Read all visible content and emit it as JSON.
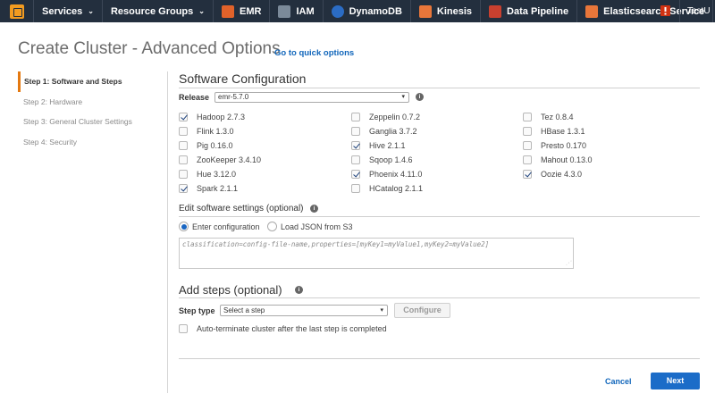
{
  "nav": {
    "services_label": "Services",
    "resource_groups_label": "Resource Groups",
    "caret": "⌄",
    "shortcuts": [
      {
        "label": "EMR",
        "color": "#e1622a"
      },
      {
        "label": "IAM",
        "color": "#7b8a99"
      },
      {
        "label": "DynamoDB",
        "color": "#2b6cc4"
      },
      {
        "label": "Kinesis",
        "color": "#e8763a"
      },
      {
        "label": "Data Pipeline",
        "color": "#c8402f"
      },
      {
        "label": "Elasticsearch Service",
        "color": "#e8763a"
      }
    ],
    "alert_color": "#d13212",
    "user_label": "TestU"
  },
  "header": {
    "title": "Create Cluster - Advanced Options",
    "quick_link": "Go to quick options"
  },
  "steps": [
    {
      "label": "Step 1: Software and Steps",
      "active": true
    },
    {
      "label": "Step 2: Hardware",
      "active": false
    },
    {
      "label": "Step 3: General Cluster Settings",
      "active": false
    },
    {
      "label": "Step 4: Security",
      "active": false
    }
  ],
  "software": {
    "heading": "Software Configuration",
    "release_label": "Release",
    "release_value": "emr-5.7.0",
    "select_caret": "▾",
    "info_glyph": "i",
    "applications": [
      {
        "label": "Hadoop 2.7.3",
        "checked": true
      },
      {
        "label": "Zeppelin 0.7.2",
        "checked": false
      },
      {
        "label": "Tez 0.8.4",
        "checked": false
      },
      {
        "label": "Flink 1.3.0",
        "checked": false
      },
      {
        "label": "Ganglia 3.7.2",
        "checked": false
      },
      {
        "label": "HBase 1.3.1",
        "checked": false
      },
      {
        "label": "Pig 0.16.0",
        "checked": false
      },
      {
        "label": "Hive 2.1.1",
        "checked": true
      },
      {
        "label": "Presto 0.170",
        "checked": false
      },
      {
        "label": "ZooKeeper 3.4.10",
        "checked": false
      },
      {
        "label": "Sqoop 1.4.6",
        "checked": false
      },
      {
        "label": "Mahout 0.13.0",
        "checked": false
      },
      {
        "label": "Hue 3.12.0",
        "checked": false
      },
      {
        "label": "Phoenix 4.11.0",
        "checked": true
      },
      {
        "label": "Oozie 4.3.0",
        "checked": true
      },
      {
        "label": "Spark 2.1.1",
        "checked": true
      },
      {
        "label": "HCatalog 2.1.1",
        "checked": false
      }
    ]
  },
  "settings": {
    "heading": "Edit software settings (optional)",
    "option_enter": "Enter configuration",
    "option_load": "Load JSON from S3",
    "selected": "enter",
    "placeholder": "classification=config-file-name,properties=[myKey1=myValue1,myKey2=myValue2]",
    "grip": "⋰"
  },
  "steps_section": {
    "heading": "Add steps (optional)",
    "step_type_label": "Step type",
    "step_type_value": "Select a step",
    "configure_label": "Configure",
    "auto_terminate_label": "Auto-terminate cluster after the last step is completed",
    "auto_terminate_checked": false
  },
  "footer": {
    "cancel_label": "Cancel",
    "next_label": "Next"
  }
}
